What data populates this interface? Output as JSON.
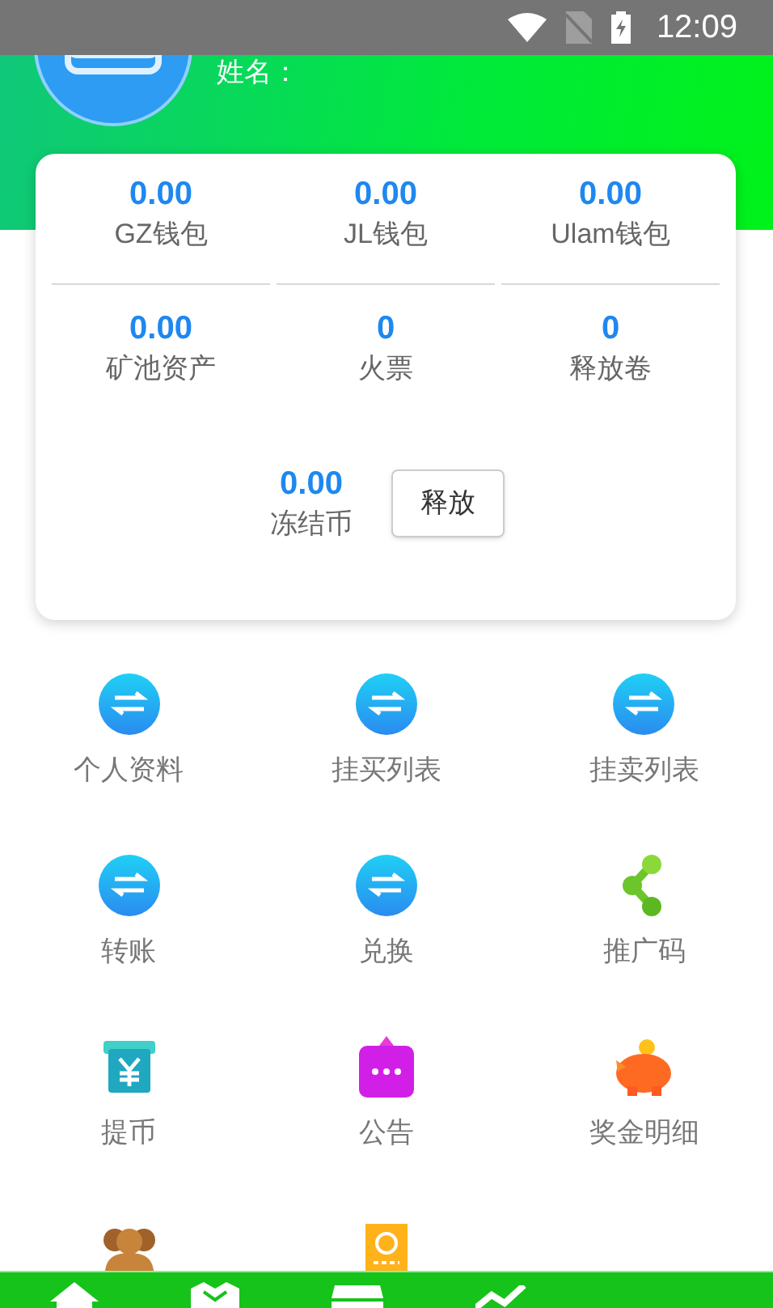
{
  "status_bar": {
    "time": "12:09"
  },
  "profile": {
    "name_label": "姓名："
  },
  "wallets": [
    {
      "value": "0.00",
      "label": "GZ钱包"
    },
    {
      "value": "0.00",
      "label": "JL钱包"
    },
    {
      "value": "0.00",
      "label": "Ulam钱包"
    },
    {
      "value": "0.00",
      "label": "矿池资产"
    },
    {
      "value": "0",
      "label": "火票"
    },
    {
      "value": "0",
      "label": "释放卷"
    }
  ],
  "frozen": {
    "value": "0.00",
    "label": "冻结币",
    "button": "释放"
  },
  "menu": [
    {
      "label": "个人资料",
      "kind": "exchange"
    },
    {
      "label": "挂买列表",
      "kind": "exchange"
    },
    {
      "label": "挂卖列表",
      "kind": "exchange"
    },
    {
      "label": "转账",
      "kind": "exchange"
    },
    {
      "label": "兑换",
      "kind": "exchange"
    },
    {
      "label": "推广码",
      "kind": "share"
    },
    {
      "label": "提币",
      "kind": "atm"
    },
    {
      "label": "公告",
      "kind": "notice"
    },
    {
      "label": "奖金明细",
      "kind": "piggy"
    },
    {
      "kind": "team"
    },
    {
      "kind": "ticket"
    }
  ],
  "bottom_nav": [
    {
      "kind": "home"
    },
    {
      "kind": "handshake"
    },
    {
      "kind": "store"
    },
    {
      "kind": "chart"
    }
  ]
}
